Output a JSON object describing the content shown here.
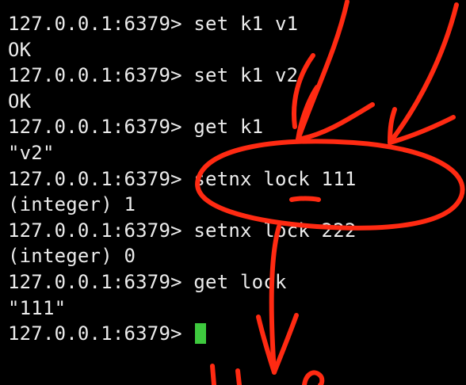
{
  "terminal": {
    "lines": [
      {
        "prompt": "127.0.0.1:6379>",
        "command": "set k1 v1"
      },
      {
        "output": "OK"
      },
      {
        "prompt": "127.0.0.1:6379>",
        "command": "set k1 v2"
      },
      {
        "output": "OK"
      },
      {
        "prompt": "127.0.0.1:6379>",
        "command": "get k1"
      },
      {
        "output": "\"v2\""
      },
      {
        "prompt": "127.0.0.1:6379>",
        "command": "setnx lock 111"
      },
      {
        "output": "(integer) 1"
      },
      {
        "prompt": "127.0.0.1:6379>",
        "command": "setnx lock 222"
      },
      {
        "output": "(integer) 0"
      },
      {
        "prompt": "127.0.0.1:6379>",
        "command": "get lock"
      },
      {
        "output": "\"111\""
      }
    ],
    "current_prompt": "127.0.0.1:6379>",
    "colors": {
      "background": "#000000",
      "text": "#ececec",
      "cursor": "#3ec93e",
      "annotation": "#ff2a12"
    }
  }
}
